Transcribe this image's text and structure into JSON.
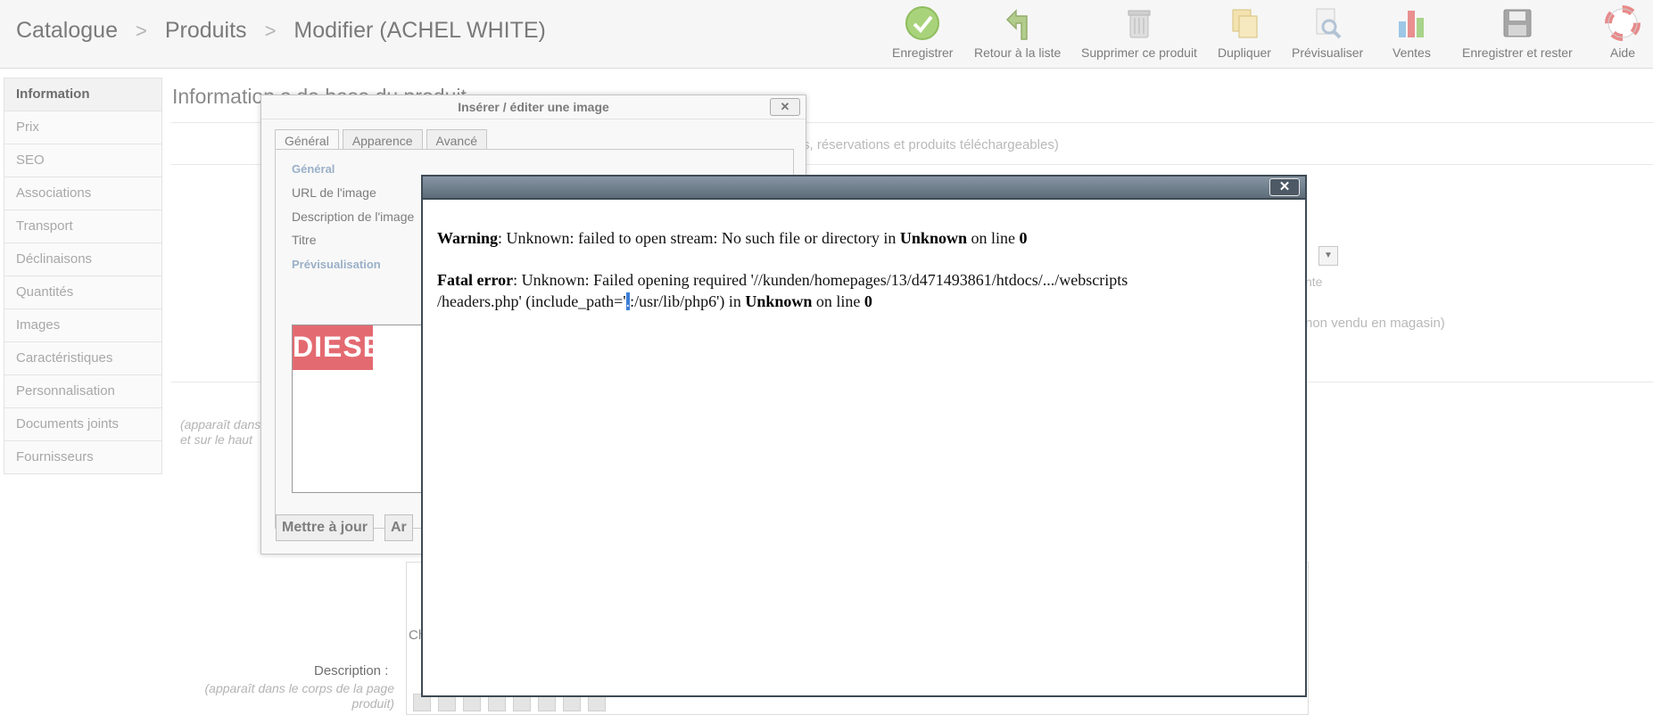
{
  "breadcrumb": {
    "items": [
      "Catalogue",
      "Produits",
      "Modifier (ACHEL WHITE)"
    ],
    "separator": ">"
  },
  "toolbar": {
    "save": "Enregistrer",
    "back": "Retour à la liste",
    "delete": "Supprimer ce produit",
    "duplicate": "Dupliquer",
    "preview": "Prévisualiser",
    "sales": "Ventes",
    "save_stay": "Enregistrer et rester",
    "help": "Aide"
  },
  "tabmenu": {
    "items": [
      "Information",
      "Prix",
      "SEO",
      "Associations",
      "Transport",
      "Déclinaisons",
      "Quantités",
      "Images",
      "Caractéristiques",
      "Personnalisation",
      "Documents joints",
      "Fournisseurs"
    ]
  },
  "background": {
    "section_title": "Information",
    "section_title_hidden": "s de base du produit",
    "type_text": "s, réservations et produits téléchargeables)",
    "avail_text": "nte",
    "online_only": "non vendu en magasin)",
    "short_desc_hint_1": "(apparaît dans",
    "short_desc_hint_2": "et sur le haut",
    "ch_text": "Ch",
    "description_label": "Description :",
    "description_hint": "(apparaît dans le corps de la page produit)"
  },
  "image_dialog": {
    "title": "Insérer / éditer une image",
    "close": "✕",
    "tabs": [
      "Général",
      "Apparence",
      "Avancé"
    ],
    "legend_general": "Général",
    "fields": [
      "URL de l'image",
      "Description de l'image",
      "Titre"
    ],
    "legend_preview": "Prévisualisation",
    "preview_image_text": "DIESEL",
    "update_button": "Mettre à jour",
    "cancel_button": "Ar"
  },
  "error_dialog": {
    "close": "✕",
    "warning_label": "Warning",
    "warning_text": ": Unknown: failed to open stream: No such file or directory in ",
    "warning_file": "Unknown",
    "warning_line_text": " on line ",
    "warning_line": "0",
    "fatal_label": "Fatal error",
    "fatal_text_1": ": Unknown: Failed opening required '//kunden/homepages/13/d471493861/htdocs/.../webscripts",
    "fatal_text_2a": "/headers.php' (include_path='",
    "fatal_caret": ".",
    "fatal_text_2b": ":/usr/lib/php6') in ",
    "fatal_file": "Unknown",
    "fatal_line_text": " on line ",
    "fatal_line": "0"
  }
}
